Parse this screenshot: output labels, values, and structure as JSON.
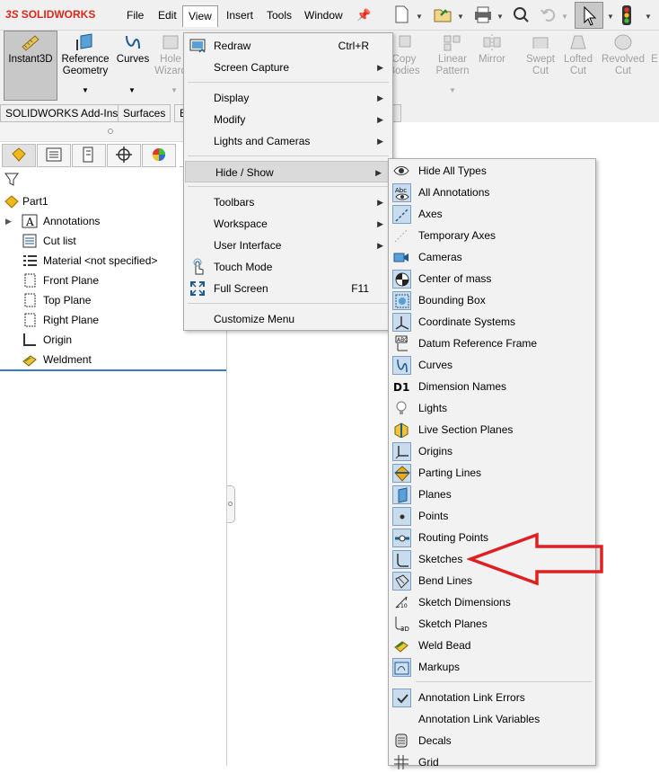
{
  "app": {
    "brand_prefix": "3S",
    "brand": "SOLIDWORKS"
  },
  "menubar": {
    "items": [
      "File",
      "Edit",
      "View",
      "Insert",
      "Tools",
      "Window"
    ],
    "active": "View"
  },
  "commands": [
    {
      "label": "Instant3D",
      "enabled": true
    },
    {
      "label": "Reference\nGeometry",
      "enabled": true
    },
    {
      "label": "Curves",
      "enabled": true
    },
    {
      "label": "Hole\nWizard",
      "enabled": false
    },
    {
      "label": "Copy\nBodies",
      "enabled": false
    },
    {
      "label": "Linear\nPattern",
      "enabled": false
    },
    {
      "label": "Mirror",
      "enabled": false
    },
    {
      "label": "Swept\nCut",
      "enabled": false
    },
    {
      "label": "Lofted\nCut",
      "enabled": false
    },
    {
      "label": "Revolved\nCut",
      "enabled": false
    }
  ],
  "tabs": [
    "SOLIDWORKS Add-Ins",
    "Surfaces",
    "E"
  ],
  "tree": {
    "root": "Part1",
    "items": [
      {
        "label": "Annotations",
        "icon": "annotations-icon",
        "expandable": true
      },
      {
        "label": "Cut list",
        "icon": "cut-list-icon"
      },
      {
        "label": "Material <not specified>",
        "icon": "material-icon"
      },
      {
        "label": "Front Plane",
        "icon": "plane-icon"
      },
      {
        "label": "Top Plane",
        "icon": "plane-icon"
      },
      {
        "label": "Right Plane",
        "icon": "plane-icon"
      },
      {
        "label": "Origin",
        "icon": "origin-icon"
      },
      {
        "label": "Weldment",
        "icon": "weldment-icon"
      }
    ]
  },
  "view_menu": {
    "items": [
      {
        "label": "Redraw",
        "shortcut": "Ctrl+R",
        "icon": "redraw-icon"
      },
      {
        "label": "Screen Capture",
        "submenu": true
      },
      {
        "separator": true
      },
      {
        "label": "Display",
        "submenu": true
      },
      {
        "label": "Modify",
        "submenu": true
      },
      {
        "label": "Lights and Cameras",
        "submenu": true
      },
      {
        "separator": true
      },
      {
        "label": "Hide / Show",
        "submenu": true,
        "highlighted": true
      },
      {
        "separator": true
      },
      {
        "label": "Toolbars",
        "submenu": true
      },
      {
        "label": "Workspace",
        "submenu": true
      },
      {
        "label": "User Interface",
        "submenu": true
      },
      {
        "label": "Touch Mode",
        "icon": "touch-icon"
      },
      {
        "label": "Full Screen",
        "shortcut": "F11",
        "icon": "fullscreen-icon"
      },
      {
        "separator": true
      },
      {
        "label": "Customize Menu"
      }
    ]
  },
  "hide_show_menu": {
    "items": [
      {
        "label": "Hide All Types",
        "icon": "eye-icon",
        "checked": false
      },
      {
        "label": "All Annotations",
        "icon": "all-annotations-icon",
        "checked": true
      },
      {
        "label": "Axes",
        "icon": "axes-icon",
        "checked": true
      },
      {
        "label": "Temporary Axes",
        "icon": "temporary-axes-icon",
        "checked": false
      },
      {
        "label": "Cameras",
        "icon": "camera-icon",
        "checked": false
      },
      {
        "label": "Center of mass",
        "icon": "center-of-mass-icon",
        "checked": true
      },
      {
        "label": "Bounding Box",
        "icon": "bounding-box-icon",
        "checked": true
      },
      {
        "label": "Coordinate Systems",
        "icon": "coordinate-system-icon",
        "checked": true
      },
      {
        "label": "Datum Reference Frame",
        "icon": "datum-reference-icon",
        "checked": false
      },
      {
        "label": "Curves",
        "icon": "curves-icon",
        "checked": true
      },
      {
        "label": "Dimension Names",
        "icon": "dimension-names-icon",
        "checked": false
      },
      {
        "label": "Lights",
        "icon": "lights-icon",
        "checked": false
      },
      {
        "label": "Live Section Planes",
        "icon": "live-section-icon",
        "checked": false
      },
      {
        "label": "Origins",
        "icon": "origins-icon",
        "checked": true
      },
      {
        "label": "Parting Lines",
        "icon": "parting-lines-icon",
        "checked": true
      },
      {
        "label": "Planes",
        "icon": "planes-icon",
        "checked": true
      },
      {
        "label": "Points",
        "icon": "points-icon",
        "checked": true
      },
      {
        "label": "Routing Points",
        "icon": "routing-points-icon",
        "checked": true
      },
      {
        "label": "Sketches",
        "icon": "sketches-icon",
        "checked": true
      },
      {
        "label": "Bend Lines",
        "icon": "bend-lines-icon",
        "checked": true
      },
      {
        "label": "Sketch Dimensions",
        "icon": "sketch-dimensions-icon",
        "checked": false
      },
      {
        "label": "Sketch Planes",
        "icon": "sketch-planes-icon",
        "checked": false
      },
      {
        "label": "Weld Bead",
        "icon": "weld-bead-icon",
        "checked": false
      },
      {
        "label": "Markups",
        "icon": "markups-icon",
        "checked": true
      },
      {
        "separator": true
      },
      {
        "label": "Annotation Link Errors",
        "icon": "checkmark-icon",
        "checked": true
      },
      {
        "label": "Annotation Link Variables",
        "icon": "",
        "checked": false
      },
      {
        "label": "Decals",
        "icon": "decals-icon",
        "checked": false
      },
      {
        "label": "Grid",
        "icon": "grid-icon",
        "checked": false
      }
    ]
  },
  "colors": {
    "brand": "#da291c",
    "annotation_arrow": "#e02020",
    "checked_bg": "#c9dcee",
    "blue_bar": "#3a7ac0"
  }
}
